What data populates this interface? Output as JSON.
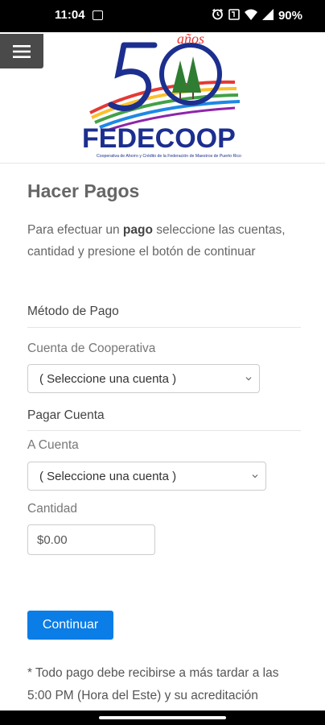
{
  "status": {
    "time": "11:04",
    "battery": "90%"
  },
  "logo": {
    "anos": "años",
    "number": "50",
    "name": "FEDECOOP",
    "tagline": "Cooperativa de Ahorro y Crédito de la Federación de Maestros de Puerto Rico"
  },
  "page": {
    "title": "Hacer Pagos",
    "intro_pre": "Para efectuar un ",
    "intro_bold": "pago",
    "intro_post": " seleccione las cuentas, cantidad y presione el botón de continuar"
  },
  "form": {
    "method_heading": "Método de Pago",
    "source_label": "Cuenta de Cooperativa",
    "source_value": "( Seleccione una cuenta )",
    "pay_heading": "Pagar Cuenta",
    "target_label": "A Cuenta",
    "target_value": "( Seleccione una cuenta )",
    "amount_label": "Cantidad",
    "amount_value": "$0.00",
    "continue_label": "Continuar"
  },
  "footer_note": "* Todo pago debe recibirse a más tardar a las 5:00 PM (Hora del Este) y su acreditación",
  "colors": {
    "primary_button": "#0b7de6",
    "logo_blue": "#1c2f8f"
  }
}
